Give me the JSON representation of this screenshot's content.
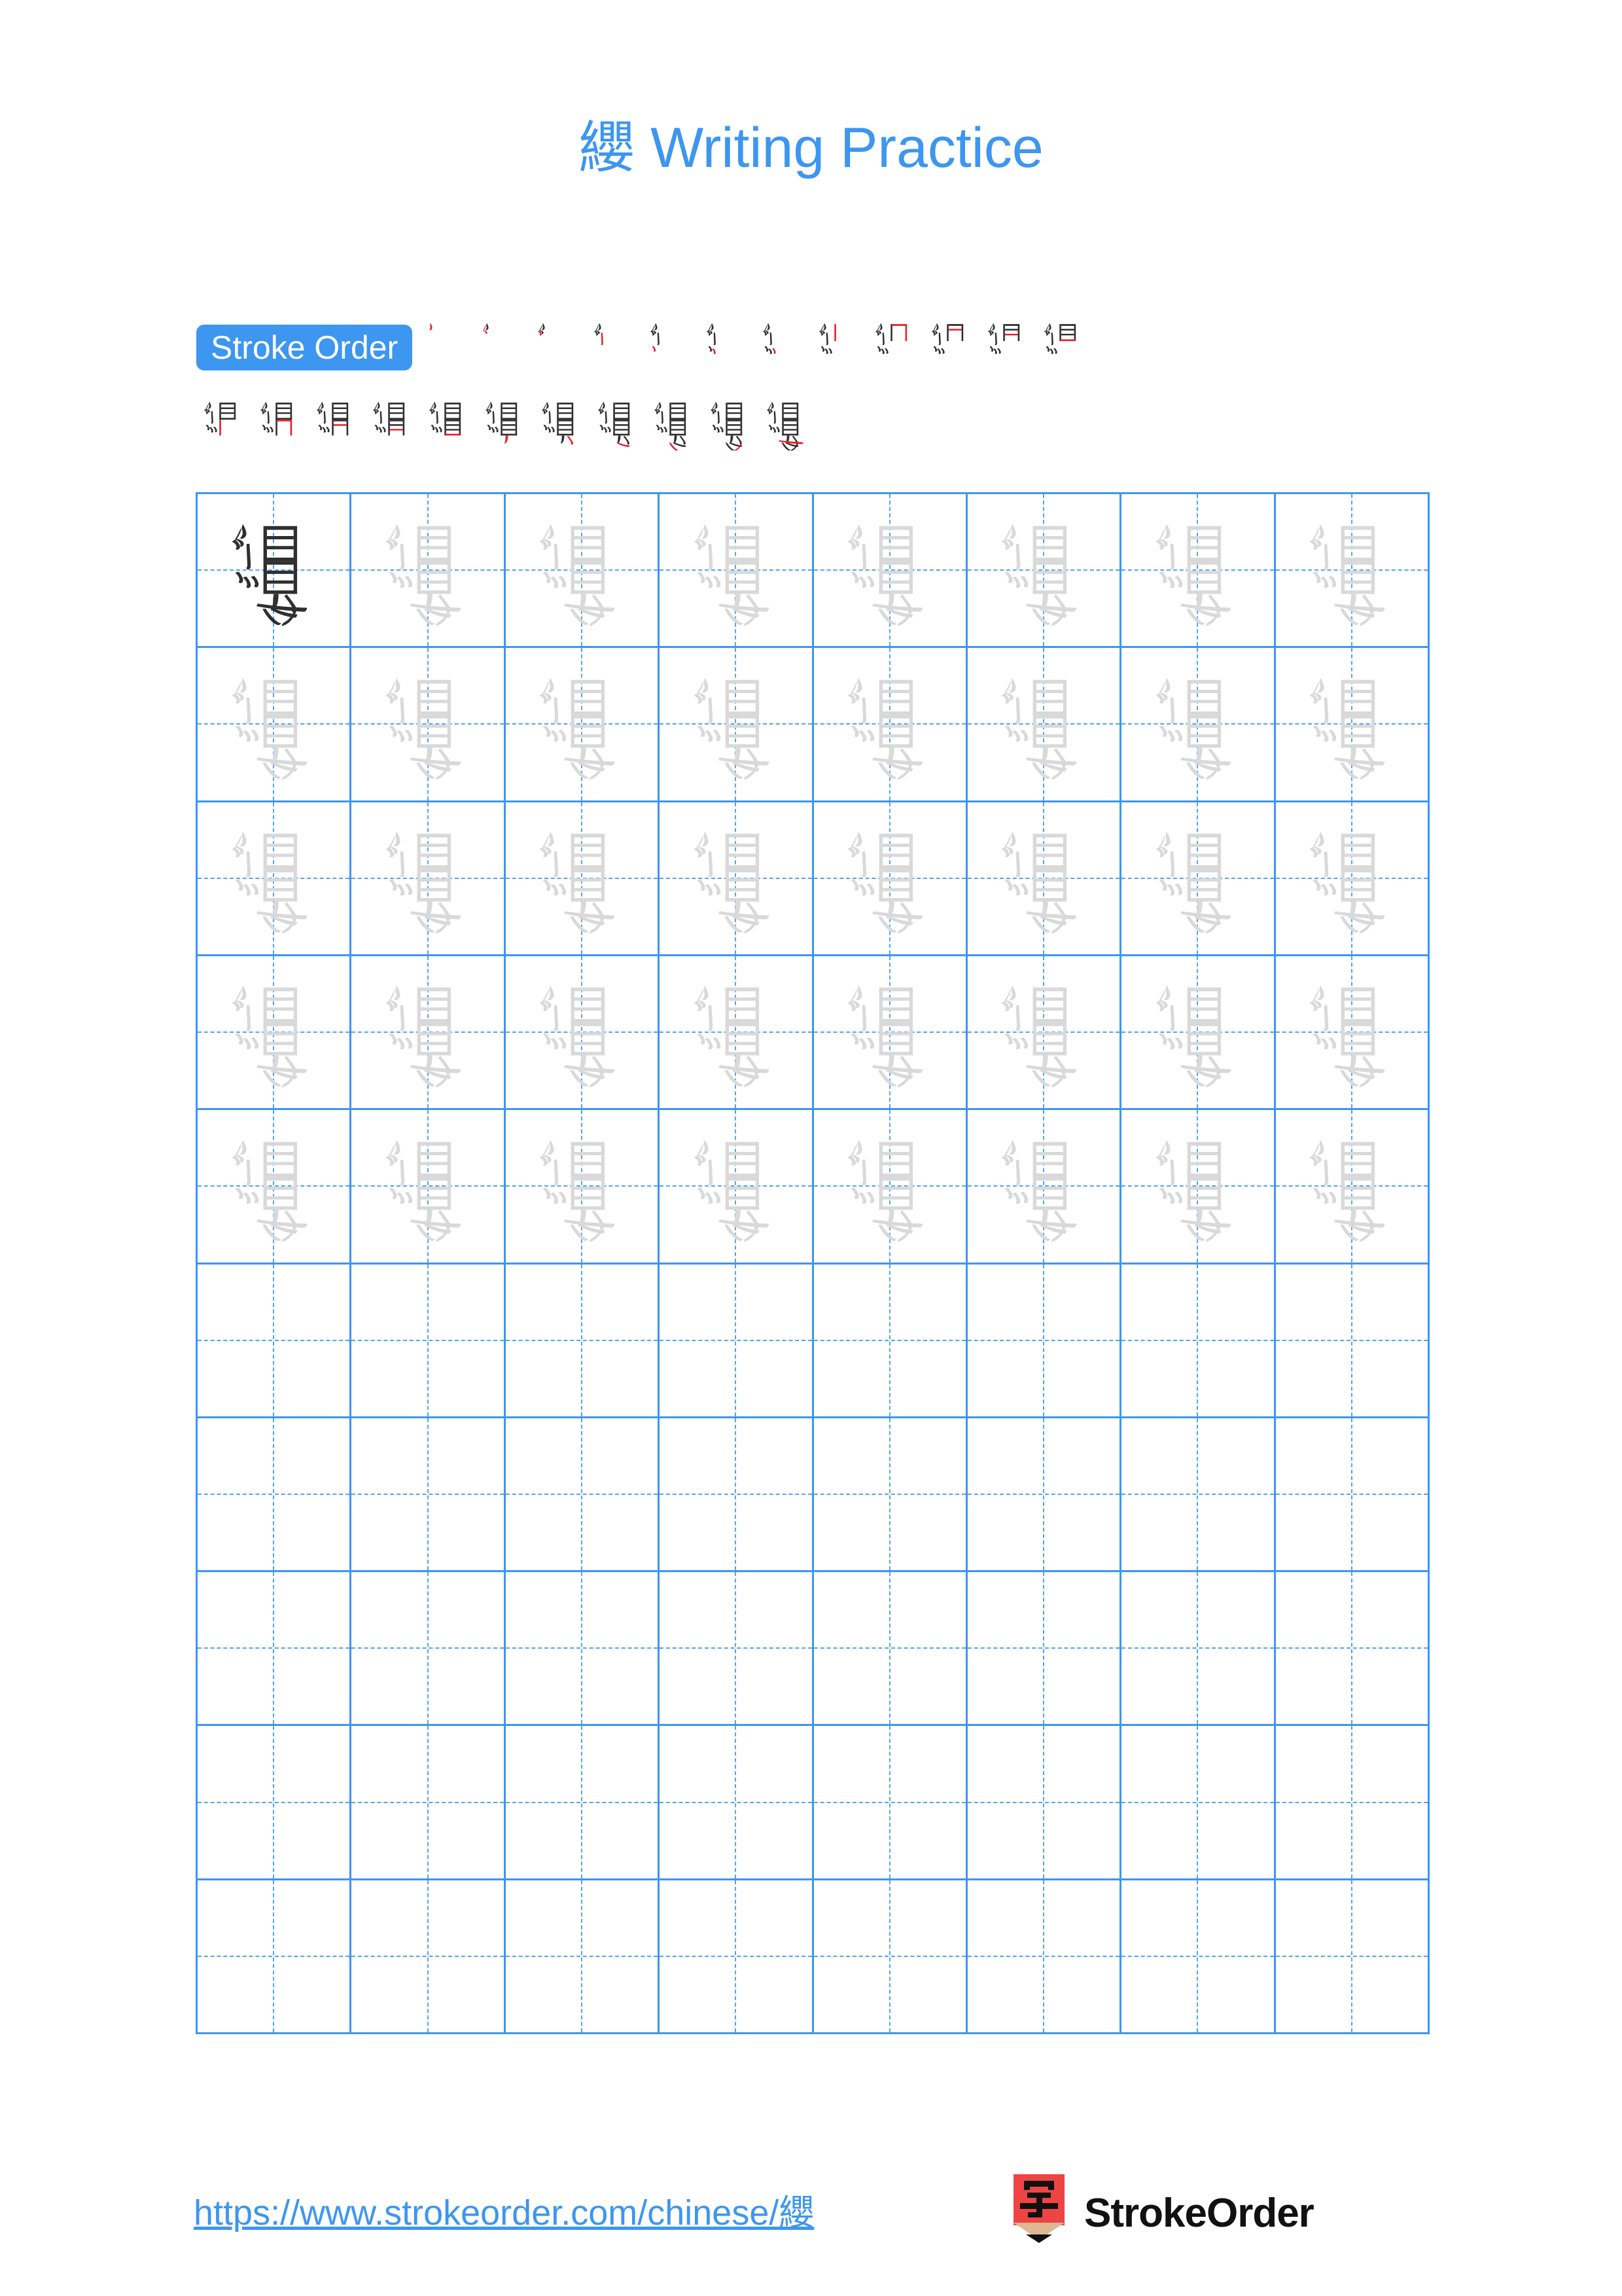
{
  "page": {
    "background_color": "#ffffff",
    "accent_color": "#3d96f0",
    "grid_line_color": "#3d96f0",
    "guide_char_color": "#d9d9d9",
    "model_char_color": "#2f2f2f",
    "highlight_stroke_color": "#ee1c25"
  },
  "title": {
    "character": "纓",
    "text": "Writing Practice",
    "full": "纓 Writing Practice"
  },
  "stroke_order": {
    "badge_label": "Stroke Order",
    "character": "纓",
    "total_strokes": 23,
    "row_counts": [
      12,
      11
    ],
    "steps": [
      {
        "index": 1,
        "strokes_shown": 1
      },
      {
        "index": 2,
        "strokes_shown": 2
      },
      {
        "index": 3,
        "strokes_shown": 3
      },
      {
        "index": 4,
        "strokes_shown": 4
      },
      {
        "index": 5,
        "strokes_shown": 5
      },
      {
        "index": 6,
        "strokes_shown": 6
      },
      {
        "index": 7,
        "strokes_shown": 7
      },
      {
        "index": 8,
        "strokes_shown": 8
      },
      {
        "index": 9,
        "strokes_shown": 9
      },
      {
        "index": 10,
        "strokes_shown": 10
      },
      {
        "index": 11,
        "strokes_shown": 11
      },
      {
        "index": 12,
        "strokes_shown": 12
      },
      {
        "index": 13,
        "strokes_shown": 13
      },
      {
        "index": 14,
        "strokes_shown": 14
      },
      {
        "index": 15,
        "strokes_shown": 15
      },
      {
        "index": 16,
        "strokes_shown": 16
      },
      {
        "index": 17,
        "strokes_shown": 17
      },
      {
        "index": 18,
        "strokes_shown": 18
      },
      {
        "index": 19,
        "strokes_shown": 19
      },
      {
        "index": 20,
        "strokes_shown": 20
      },
      {
        "index": 21,
        "strokes_shown": 21
      },
      {
        "index": 22,
        "strokes_shown": 22
      },
      {
        "index": 23,
        "strokes_shown": 23
      }
    ]
  },
  "practice_grid": {
    "columns": 8,
    "rows": 10,
    "total_cells": 80,
    "model_cells": 1,
    "traced_cells": 39,
    "blank_cells": 40,
    "character": "纓",
    "cells": [
      "model",
      "trace",
      "trace",
      "trace",
      "trace",
      "trace",
      "trace",
      "trace",
      "trace",
      "trace",
      "trace",
      "trace",
      "trace",
      "trace",
      "trace",
      "trace",
      "trace",
      "trace",
      "trace",
      "trace",
      "trace",
      "trace",
      "trace",
      "trace",
      "trace",
      "trace",
      "trace",
      "trace",
      "trace",
      "trace",
      "trace",
      "trace",
      "trace",
      "trace",
      "trace",
      "trace",
      "trace",
      "trace",
      "trace",
      "trace",
      "blank",
      "blank",
      "blank",
      "blank",
      "blank",
      "blank",
      "blank",
      "blank",
      "blank",
      "blank",
      "blank",
      "blank",
      "blank",
      "blank",
      "blank",
      "blank",
      "blank",
      "blank",
      "blank",
      "blank",
      "blank",
      "blank",
      "blank",
      "blank",
      "blank",
      "blank",
      "blank",
      "blank",
      "blank",
      "blank",
      "blank",
      "blank",
      "blank",
      "blank",
      "blank",
      "blank",
      "blank",
      "blank",
      "blank",
      "blank"
    ]
  },
  "footer": {
    "url": "https://www.strokeorder.com/chinese/纓",
    "brand_name": "StrokeOrder",
    "logo_character": "字",
    "logo_body_color": "#ef4444",
    "logo_wood_color": "#ddb892",
    "logo_tip_color": "#111111"
  }
}
